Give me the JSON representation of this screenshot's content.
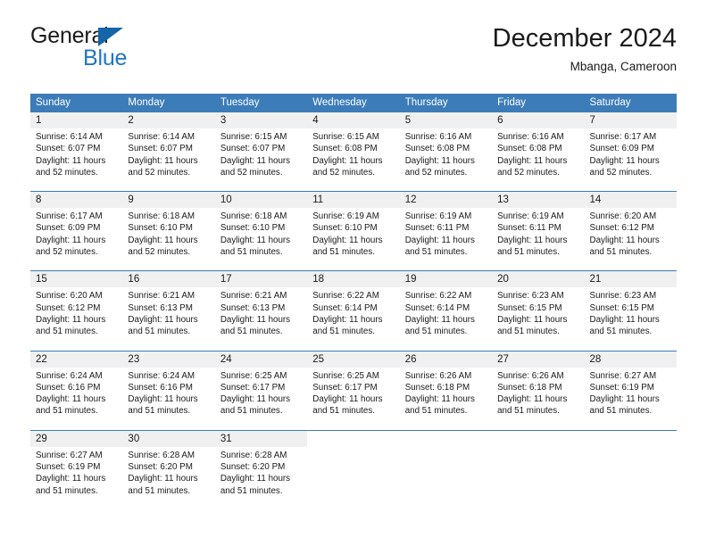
{
  "brand": {
    "word_one": "General",
    "word_two": "Blue",
    "triangle_color": "#1565a8",
    "blue_color": "#2076c4"
  },
  "header": {
    "title": "December 2024",
    "subtitle": "Mbanga, Cameroon"
  },
  "theme": {
    "header_blue": "#3c7cb8",
    "daynum_bg": "#f0f0f0",
    "text": "#1a1a1a"
  },
  "calendar": {
    "weekday_headers": [
      "Sunday",
      "Monday",
      "Tuesday",
      "Wednesday",
      "Thursday",
      "Friday",
      "Saturday"
    ],
    "weeks": [
      [
        {
          "day": "1",
          "sunrise": "Sunrise: 6:14 AM",
          "sunset": "Sunset: 6:07 PM",
          "daylight": "Daylight: 11 hours and 52 minutes."
        },
        {
          "day": "2",
          "sunrise": "Sunrise: 6:14 AM",
          "sunset": "Sunset: 6:07 PM",
          "daylight": "Daylight: 11 hours and 52 minutes."
        },
        {
          "day": "3",
          "sunrise": "Sunrise: 6:15 AM",
          "sunset": "Sunset: 6:07 PM",
          "daylight": "Daylight: 11 hours and 52 minutes."
        },
        {
          "day": "4",
          "sunrise": "Sunrise: 6:15 AM",
          "sunset": "Sunset: 6:08 PM",
          "daylight": "Daylight: 11 hours and 52 minutes."
        },
        {
          "day": "5",
          "sunrise": "Sunrise: 6:16 AM",
          "sunset": "Sunset: 6:08 PM",
          "daylight": "Daylight: 11 hours and 52 minutes."
        },
        {
          "day": "6",
          "sunrise": "Sunrise: 6:16 AM",
          "sunset": "Sunset: 6:08 PM",
          "daylight": "Daylight: 11 hours and 52 minutes."
        },
        {
          "day": "7",
          "sunrise": "Sunrise: 6:17 AM",
          "sunset": "Sunset: 6:09 PM",
          "daylight": "Daylight: 11 hours and 52 minutes."
        }
      ],
      [
        {
          "day": "8",
          "sunrise": "Sunrise: 6:17 AM",
          "sunset": "Sunset: 6:09 PM",
          "daylight": "Daylight: 11 hours and 52 minutes."
        },
        {
          "day": "9",
          "sunrise": "Sunrise: 6:18 AM",
          "sunset": "Sunset: 6:10 PM",
          "daylight": "Daylight: 11 hours and 52 minutes."
        },
        {
          "day": "10",
          "sunrise": "Sunrise: 6:18 AM",
          "sunset": "Sunset: 6:10 PM",
          "daylight": "Daylight: 11 hours and 51 minutes."
        },
        {
          "day": "11",
          "sunrise": "Sunrise: 6:19 AM",
          "sunset": "Sunset: 6:10 PM",
          "daylight": "Daylight: 11 hours and 51 minutes."
        },
        {
          "day": "12",
          "sunrise": "Sunrise: 6:19 AM",
          "sunset": "Sunset: 6:11 PM",
          "daylight": "Daylight: 11 hours and 51 minutes."
        },
        {
          "day": "13",
          "sunrise": "Sunrise: 6:19 AM",
          "sunset": "Sunset: 6:11 PM",
          "daylight": "Daylight: 11 hours and 51 minutes."
        },
        {
          "day": "14",
          "sunrise": "Sunrise: 6:20 AM",
          "sunset": "Sunset: 6:12 PM",
          "daylight": "Daylight: 11 hours and 51 minutes."
        }
      ],
      [
        {
          "day": "15",
          "sunrise": "Sunrise: 6:20 AM",
          "sunset": "Sunset: 6:12 PM",
          "daylight": "Daylight: 11 hours and 51 minutes."
        },
        {
          "day": "16",
          "sunrise": "Sunrise: 6:21 AM",
          "sunset": "Sunset: 6:13 PM",
          "daylight": "Daylight: 11 hours and 51 minutes."
        },
        {
          "day": "17",
          "sunrise": "Sunrise: 6:21 AM",
          "sunset": "Sunset: 6:13 PM",
          "daylight": "Daylight: 11 hours and 51 minutes."
        },
        {
          "day": "18",
          "sunrise": "Sunrise: 6:22 AM",
          "sunset": "Sunset: 6:14 PM",
          "daylight": "Daylight: 11 hours and 51 minutes."
        },
        {
          "day": "19",
          "sunrise": "Sunrise: 6:22 AM",
          "sunset": "Sunset: 6:14 PM",
          "daylight": "Daylight: 11 hours and 51 minutes."
        },
        {
          "day": "20",
          "sunrise": "Sunrise: 6:23 AM",
          "sunset": "Sunset: 6:15 PM",
          "daylight": "Daylight: 11 hours and 51 minutes."
        },
        {
          "day": "21",
          "sunrise": "Sunrise: 6:23 AM",
          "sunset": "Sunset: 6:15 PM",
          "daylight": "Daylight: 11 hours and 51 minutes."
        }
      ],
      [
        {
          "day": "22",
          "sunrise": "Sunrise: 6:24 AM",
          "sunset": "Sunset: 6:16 PM",
          "daylight": "Daylight: 11 hours and 51 minutes."
        },
        {
          "day": "23",
          "sunrise": "Sunrise: 6:24 AM",
          "sunset": "Sunset: 6:16 PM",
          "daylight": "Daylight: 11 hours and 51 minutes."
        },
        {
          "day": "24",
          "sunrise": "Sunrise: 6:25 AM",
          "sunset": "Sunset: 6:17 PM",
          "daylight": "Daylight: 11 hours and 51 minutes."
        },
        {
          "day": "25",
          "sunrise": "Sunrise: 6:25 AM",
          "sunset": "Sunset: 6:17 PM",
          "daylight": "Daylight: 11 hours and 51 minutes."
        },
        {
          "day": "26",
          "sunrise": "Sunrise: 6:26 AM",
          "sunset": "Sunset: 6:18 PM",
          "daylight": "Daylight: 11 hours and 51 minutes."
        },
        {
          "day": "27",
          "sunrise": "Sunrise: 6:26 AM",
          "sunset": "Sunset: 6:18 PM",
          "daylight": "Daylight: 11 hours and 51 minutes."
        },
        {
          "day": "28",
          "sunrise": "Sunrise: 6:27 AM",
          "sunset": "Sunset: 6:19 PM",
          "daylight": "Daylight: 11 hours and 51 minutes."
        }
      ],
      [
        {
          "day": "29",
          "sunrise": "Sunrise: 6:27 AM",
          "sunset": "Sunset: 6:19 PM",
          "daylight": "Daylight: 11 hours and 51 minutes."
        },
        {
          "day": "30",
          "sunrise": "Sunrise: 6:28 AM",
          "sunset": "Sunset: 6:20 PM",
          "daylight": "Daylight: 11 hours and 51 minutes."
        },
        {
          "day": "31",
          "sunrise": "Sunrise: 6:28 AM",
          "sunset": "Sunset: 6:20 PM",
          "daylight": "Daylight: 11 hours and 51 minutes."
        },
        {
          "day": "",
          "sunrise": "",
          "sunset": "",
          "daylight": ""
        },
        {
          "day": "",
          "sunrise": "",
          "sunset": "",
          "daylight": ""
        },
        {
          "day": "",
          "sunrise": "",
          "sunset": "",
          "daylight": ""
        },
        {
          "day": "",
          "sunrise": "",
          "sunset": "",
          "daylight": ""
        }
      ]
    ]
  }
}
